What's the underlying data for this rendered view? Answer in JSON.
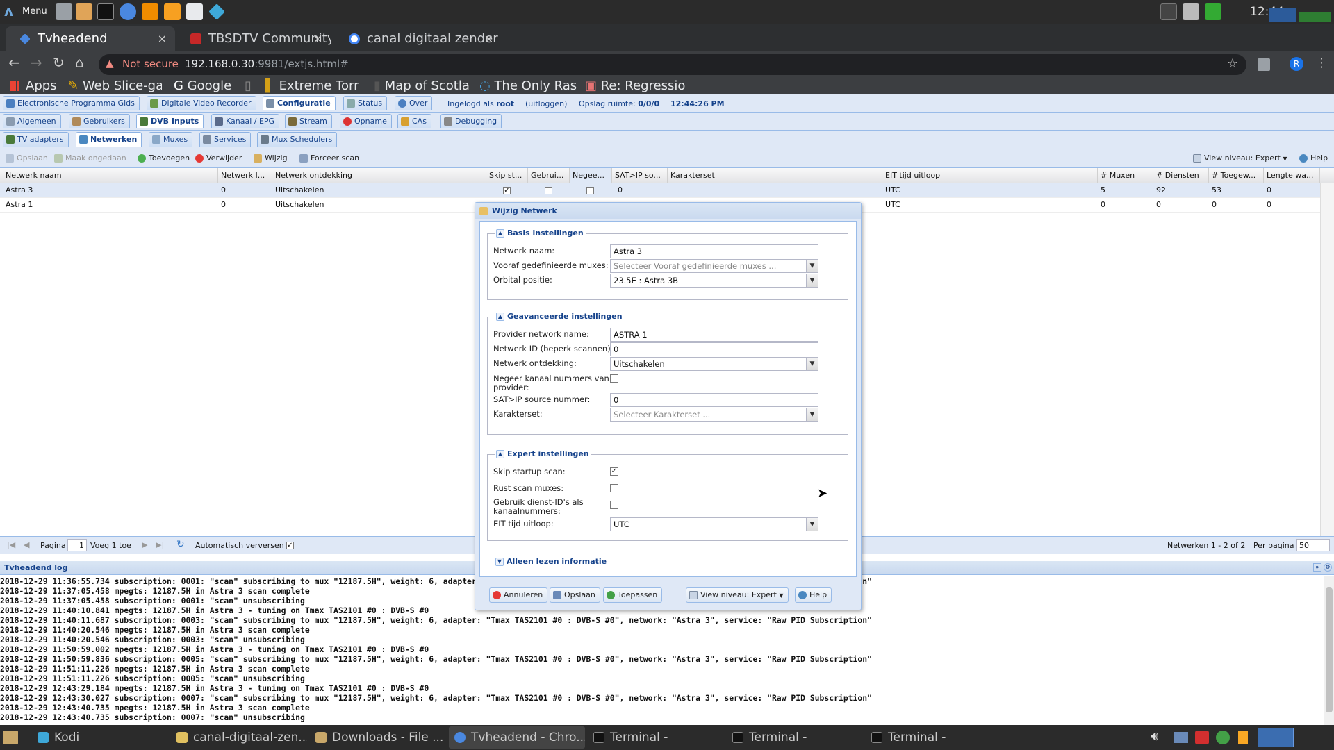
{
  "system_panel": {
    "menu_label": "Menu",
    "clock": "12:44"
  },
  "browser": {
    "tabs": [
      {
        "label": "Tvheadend",
        "close": "×"
      },
      {
        "label": "TBSDTV Community",
        "close": "×"
      },
      {
        "label": "canal digitaal zender",
        "close": "×"
      }
    ],
    "new_tab": "+",
    "security_label": "Not secure",
    "url_host": "192.168.0.30",
    "url_rest": ":9981/extjs.html#",
    "profile_initial": "R",
    "bookmarks": [
      "Apps",
      "Web Slice-ga",
      "Google",
      "",
      "Extreme Torr",
      "Map of Scotla",
      "The Only Ras",
      "Re: Regressio"
    ]
  },
  "app": {
    "top_tabs": [
      "Electronische Programma Gids",
      "Digitale Video Recorder",
      "Configuratie",
      "Status",
      "Over"
    ],
    "login_prefix": "Ingelogd als",
    "login_user": "root",
    "logout": "(uitloggen)",
    "storage_label": "Opslag ruimte:",
    "storage_value": "0/0/0",
    "server_time": "12:44:26 PM",
    "config_tabs": [
      "Algemeen",
      "Gebruikers",
      "DVB Inputs",
      "Kanaal / EPG",
      "Stream",
      "Opname",
      "CAs",
      "Debugging"
    ],
    "dvb_tabs": [
      "TV adapters",
      "Netwerken",
      "Muxes",
      "Services",
      "Mux Schedulers"
    ],
    "toolbar": {
      "save": "Opslaan",
      "undo": "Maak ongedaan",
      "add": "Toevoegen",
      "delete": "Verwijder",
      "edit": "Wijzig",
      "force_scan": "Forceer scan",
      "view_level": "View niveau: Expert",
      "help": "Help"
    },
    "grid": {
      "columns": [
        "Netwerk naam",
        "Netwerk I...",
        "Netwerk ontdekking",
        "Skip st...",
        "Gebrui...",
        "Negee...",
        "SAT>IP so...",
        "Karakterset",
        "EIT tijd uitloop",
        "# Muxen",
        "# Diensten",
        "# Toegew...",
        "Lengte wa..."
      ],
      "rows": [
        {
          "name": "Astra 3",
          "nid": "0",
          "discovery": "Uitschakelen",
          "skip": true,
          "use": false,
          "ignore": false,
          "satip": "0",
          "charset": "",
          "eit": "UTC",
          "muxes": "5",
          "services": "92",
          "mapped": "53",
          "len": "0"
        },
        {
          "name": "Astra 1",
          "nid": "0",
          "discovery": "Uitschakelen",
          "skip": false,
          "use": false,
          "ignore": false,
          "satip": "",
          "charset": "",
          "eit": "UTC",
          "muxes": "0",
          "services": "0",
          "mapped": "0",
          "len": "0"
        }
      ]
    },
    "paging": {
      "page_label": "Pagina",
      "page_value": "1",
      "of_label": "Voeg 1 toe",
      "auto_refresh": "Automatisch verversen",
      "summary": "Netwerken 1 - 2 of 2",
      "per_page_label": "Per pagina",
      "per_page_value": "50"
    },
    "log": {
      "title": "Tvheadend log",
      "lines": [
        "2018-12-29 11:36:55.734 subscription: 0001: \"scan\" subscribing to mux \"12187.5H\", weight: 6, adapter: \"Tmax TAS2101 #0 : DVB-S #0\", network: \"Astra 3\", service: \"Raw PID Subscription\"",
        "2018-12-29 11:37:05.458 mpegts: 12187.5H in Astra 3 scan complete",
        "2018-12-29 11:37:05.458 subscription: 0001: \"scan\" unsubscribing",
        "2018-12-29 11:40:10.841 mpegts: 12187.5H in Astra 3 - tuning on Tmax TAS2101 #0 : DVB-S #0",
        "2018-12-29 11:40:11.687 subscription: 0003: \"scan\" subscribing to mux \"12187.5H\", weight: 6, adapter: \"Tmax TAS2101 #0 : DVB-S #0\", network: \"Astra 3\", service: \"Raw PID Subscription\"",
        "2018-12-29 11:40:20.546 mpegts: 12187.5H in Astra 3 scan complete",
        "2018-12-29 11:40:20.546 subscription: 0003: \"scan\" unsubscribing",
        "2018-12-29 11:50:59.002 mpegts: 12187.5H in Astra 3 - tuning on Tmax TAS2101 #0 : DVB-S #0",
        "2018-12-29 11:50:59.836 subscription: 0005: \"scan\" subscribing to mux \"12187.5H\", weight: 6, adapter: \"Tmax TAS2101 #0 : DVB-S #0\", network: \"Astra 3\", service: \"Raw PID Subscription\"",
        "2018-12-29 11:51:11.226 mpegts: 12187.5H in Astra 3 scan complete",
        "2018-12-29 11:51:11.226 subscription: 0005: \"scan\" unsubscribing",
        "2018-12-29 12:43:29.184 mpegts: 12187.5H in Astra 3 - tuning on Tmax TAS2101 #0 : DVB-S #0",
        "2018-12-29 12:43:30.027 subscription: 0007: \"scan\" subscribing to mux \"12187.5H\", weight: 6, adapter: \"Tmax TAS2101 #0 : DVB-S #0\", network: \"Astra 3\", service: \"Raw PID Subscription\"",
        "2018-12-29 12:43:40.735 mpegts: 12187.5H in Astra 3 scan complete",
        "2018-12-29 12:43:40.735 subscription: 0007: \"scan\" unsubscribing"
      ]
    }
  },
  "dialog": {
    "title": "Wijzig Netwerk",
    "basic": {
      "legend": "Basis instellingen",
      "network_name_label": "Netwerk naam:",
      "network_name_value": "Astra 3",
      "predef_label": "Vooraf gedefinieerde muxes:",
      "predef_placeholder": "Selecteer Vooraf gedefinieerde muxes ...",
      "orbital_label": "Orbital positie:",
      "orbital_value": "23.5E : Astra 3B"
    },
    "advanced": {
      "legend": "Geavanceerde instellingen",
      "provider_label": "Provider network name:",
      "provider_value": "ASTRA 1",
      "nid_label": "Netwerk ID (beperk scannen):",
      "nid_value": "0",
      "discovery_label": "Netwerk ontdekking:",
      "discovery_value": "Uitschakelen",
      "ignore_label": "Negeer kanaal nummers van provider:",
      "satip_label": "SAT>IP source nummer:",
      "satip_value": "0",
      "charset_label": "Karakterset:",
      "charset_placeholder": "Selecteer Karakterset ..."
    },
    "expert": {
      "legend": "Expert instellingen",
      "skip_label": "Skip startup scan:",
      "skip_checked": true,
      "idle_label": "Rust scan muxes:",
      "idle_checked": false,
      "sid_label": "Gebruik dienst-ID's als kanaalnummers:",
      "sid_checked": false,
      "eit_label": "EIT tijd uitloop:",
      "eit_value": "UTC"
    },
    "readonly_legend": "Alleen lezen informatie",
    "buttons": {
      "cancel": "Annuleren",
      "save": "Opslaan",
      "apply": "Toepassen",
      "view_level": "View niveau: Expert",
      "help": "Help"
    }
  },
  "taskbar": {
    "items": [
      "Kodi",
      "canal-digitaal-zen...",
      "Downloads - File ...",
      "Tvheadend - Chro...",
      "Terminal -",
      "Terminal -",
      "Terminal -"
    ]
  }
}
